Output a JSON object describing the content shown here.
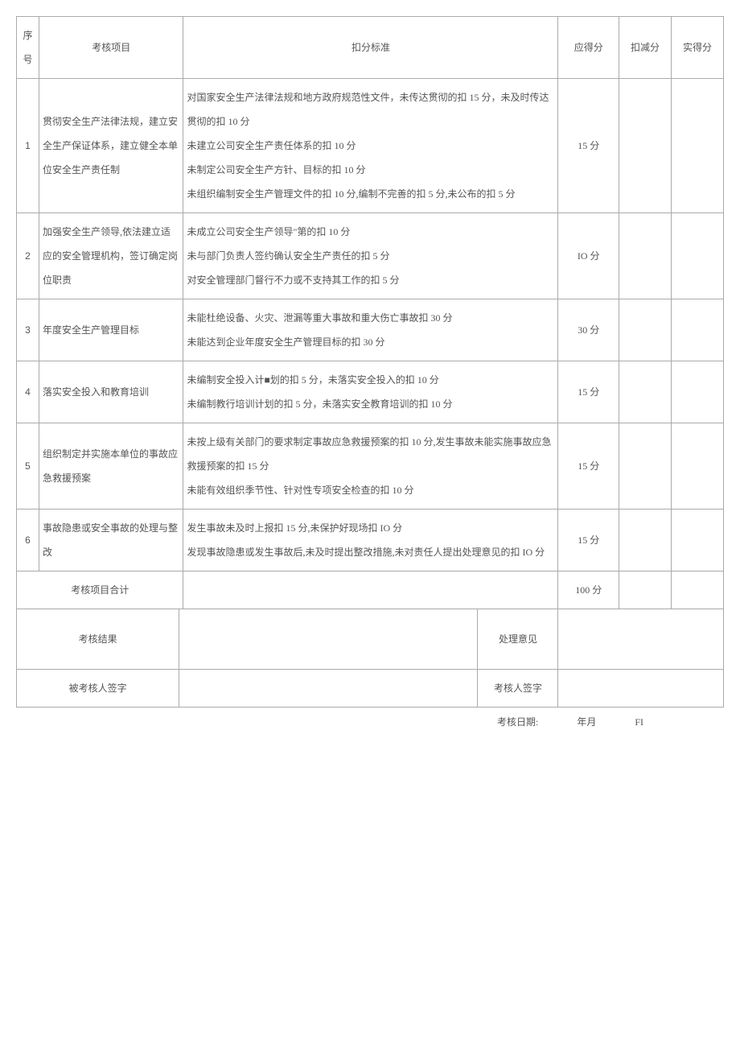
{
  "headers": {
    "num": "序号",
    "item": "考核项目",
    "standard": "扣分标准",
    "score": "应得分",
    "deduct": "扣减分",
    "actual": "实得分"
  },
  "rows": [
    {
      "num": "1",
      "item": "贯彻安全生产法律法规，建立安全生产保证体系，建立健全本单位安全生产责任制",
      "standard": "对国家安全生产法律法规和地方政府规范性文件，未传达贯彻的扣 15 分，未及时传达贯彻的扣 10 分\n未建立公司安全生产责任体系的扣 10 分\n未制定公司安全生产方针、目标的扣 10 分\n未组织编制安全生产管理文件的扣 10 分,编制不完善的扣 5 分,未公布的扣 5 分",
      "score": "15 分"
    },
    {
      "num": "2",
      "item": "加强安全生产领导,依法建立适应的安全管理机构，签订确定岗位职责",
      "standard": "未成立公司安全生产领导\"第的扣 10 分\n未与部门负责人签约确认安全生产责任的扣 5 分\n对安全管理部门督行不力或不支持其工作的扣 5 分",
      "score": "IO 分"
    },
    {
      "num": "3",
      "item": "年度安全生产管理目标",
      "standard": "未能杜绝设备、火灾、泄漏等重大事故和重大伤亡事故扣 30 分\n未能达到企业年度安全生产管理目标的扣 30 分",
      "score": "30 分"
    },
    {
      "num": "4",
      "item": "落实安全投入和教育培训",
      "standard": "未编制安全投入计■划的扣 5 分，未落实安全投入的扣 10 分\n未编制教行培训计划的扣 5 分，未落实安全教育培训的扣 10 分",
      "score": "15 分"
    },
    {
      "num": "5",
      "item": "组织制定并实施本单位的事故应急救援预案",
      "standard": "未按上级有关部门的要求制定事故应急救援预案的扣 10 分,发生事故未能实施事故应急救援预案的扣 15 分\n未能有效组织季节性、针对性专项安全检查的扣 10 分",
      "score": "15 分"
    },
    {
      "num": "6",
      "item": "事故隐患或安全事故的处理与整改",
      "standard": "发生事故未及时上报扣 15 分,未保护好现场扣 IO 分\n发现事故隐患或发生事故后,未及时提出整改措施,未对责任人提出处理意见的扣 IO 分",
      "score": "15 分"
    }
  ],
  "total": {
    "label": "考核项目合计",
    "score": "100 分"
  },
  "footer": {
    "result": "考核结果",
    "opinion": "处理意见",
    "examinee_sig": "被考核人签字",
    "examiner_sig": "考核人签字"
  },
  "date": {
    "label": "考核日期:",
    "ym": "年月",
    "fi": "FI"
  }
}
